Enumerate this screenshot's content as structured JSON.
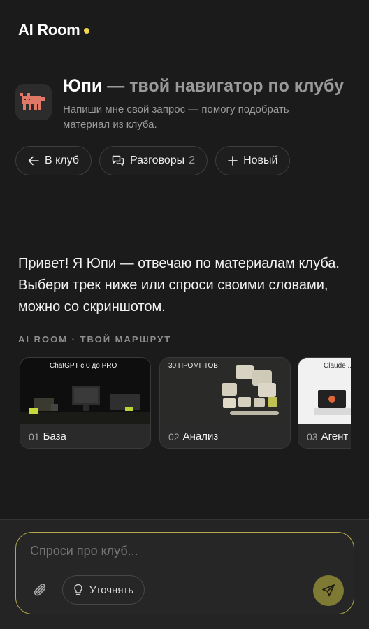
{
  "header": {
    "brand": "AI Room"
  },
  "assistant": {
    "name": "Юпи",
    "title_rest": " — твой навигатор по клубу",
    "subtitle": "Напиши мне свой запрос — помогу подобрать материал из клуба."
  },
  "nav": {
    "back_label": "В клуб",
    "conversations_label": "Разговоры",
    "conversations_count": "2",
    "new_label": "Новый"
  },
  "chat": {
    "greeting": "Привет! Я Юпи — отвечаю по материалам клуба. Выбери трек ниже или спроси своими словами, можно со скриншотом."
  },
  "route": {
    "label": "AI ROOM · ТВОЙ МАРШРУТ",
    "tracks": [
      {
        "num": "01",
        "title": "База",
        "caption": "ChatGPT с 0 до PRO"
      },
      {
        "num": "02",
        "title": "Анализ",
        "caption": "30 ПРОМПТОВ"
      },
      {
        "num": "03",
        "title": "Агент",
        "caption": "Claude ... что"
      }
    ]
  },
  "composer": {
    "placeholder": "Спроси про клуб...",
    "refine_label": "Уточнять"
  },
  "colors": {
    "accent": "#f0d84a",
    "composer_border": "#b3a94a",
    "send_bg": "#7e7a34"
  }
}
